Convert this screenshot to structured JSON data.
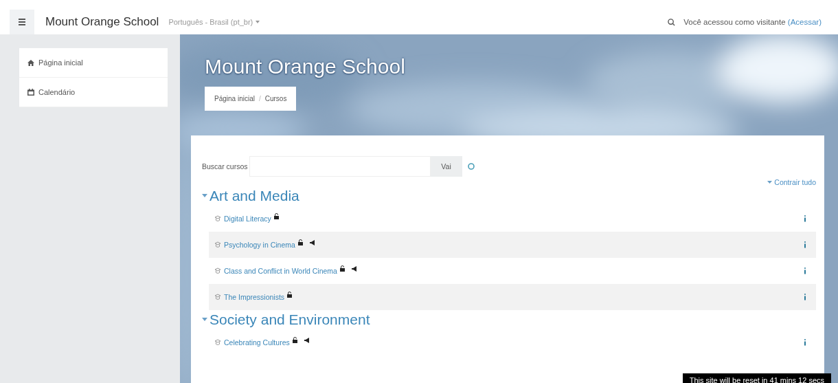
{
  "navbar": {
    "site_name": "Mount Orange School",
    "language": "Português - Brasil (pt_br)",
    "login_text": "Você acessou como visitante",
    "login_link": "(Acessar)"
  },
  "sidebar": {
    "items": [
      {
        "label": "Página inicial",
        "kind": "home"
      },
      {
        "label": "Calendário",
        "kind": "calendar"
      }
    ]
  },
  "header": {
    "title": "Mount Orange School",
    "breadcrumb": [
      "Página inicial",
      "Cursos"
    ],
    "breadcrumb_separator": "/"
  },
  "search": {
    "label": "Buscar cursos",
    "button": "Vai"
  },
  "collapse_all": "Contrair tudo",
  "categories": [
    {
      "name": "Art and Media",
      "expanded": true,
      "courses": [
        {
          "name": "Digital Literacy",
          "news": false
        },
        {
          "name": "Psychology in Cinema",
          "news": true
        },
        {
          "name": "Class and Conflict in World Cinema",
          "news": true
        },
        {
          "name": "The Impressionists",
          "news": false
        }
      ]
    },
    {
      "name": "Society and Environment",
      "expanded": true,
      "courses": [
        {
          "name": "Celebrating Cultures",
          "news": true
        }
      ]
    }
  ],
  "reset_notice": "This site will be reset in 41 mins 12 secs"
}
